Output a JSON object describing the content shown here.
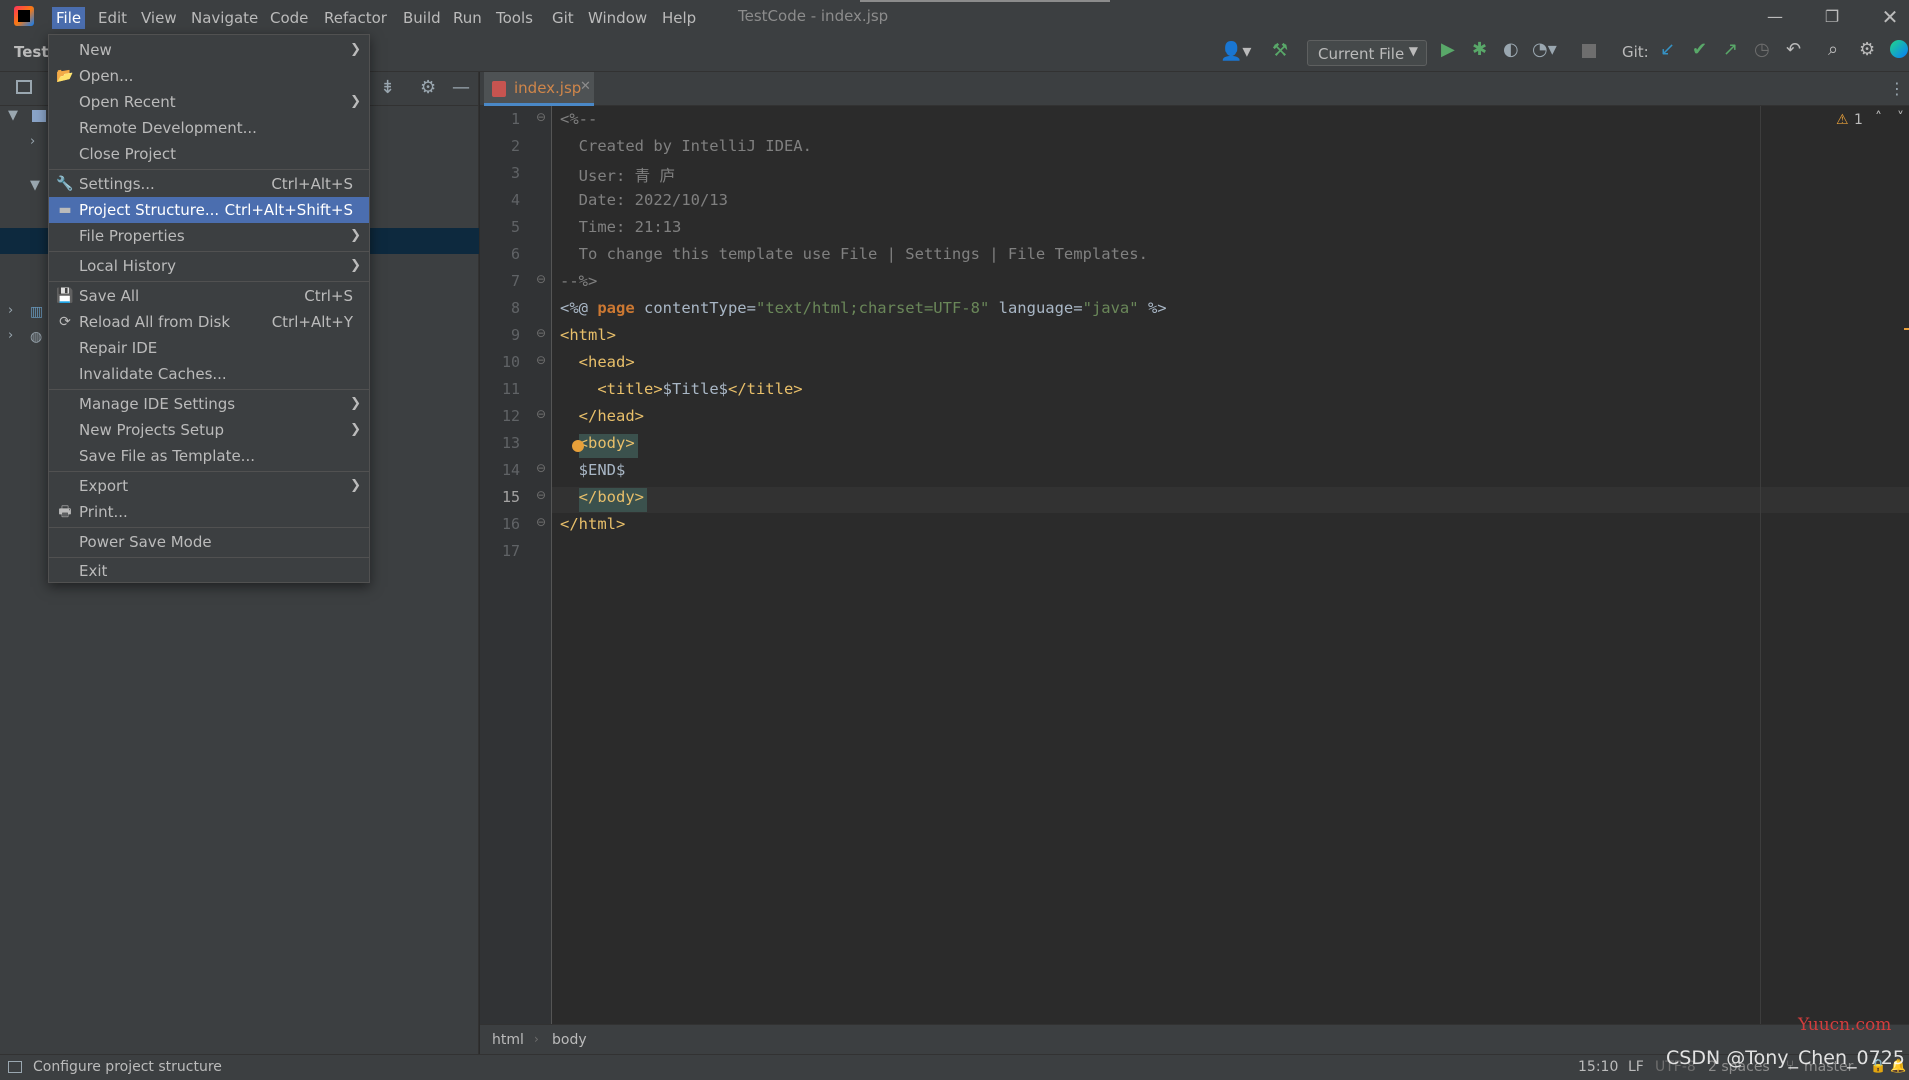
{
  "menubar": {
    "items": [
      "File",
      "Edit",
      "View",
      "Navigate",
      "Code",
      "Refactor",
      "Build",
      "Run",
      "Tools",
      "Git",
      "Window",
      "Help"
    ],
    "window_title": "TestCode - index.jsp"
  },
  "toolbar": {
    "project_label": "Test",
    "run_config": "Current File",
    "git_label": "Git:"
  },
  "file_menu": {
    "items": [
      {
        "label": "New",
        "shortcut": "",
        "submenu": true
      },
      {
        "label": "Open...",
        "shortcut": "",
        "submenu": false
      },
      {
        "label": "Open Recent",
        "shortcut": "",
        "submenu": true
      },
      {
        "label": "Remote Development...",
        "shortcut": "",
        "submenu": false
      },
      {
        "label": "Close Project",
        "shortcut": "",
        "submenu": false
      },
      {
        "label": "Settings...",
        "shortcut": "Ctrl+Alt+S",
        "submenu": false
      },
      {
        "label": "Project Structure...",
        "shortcut": "Ctrl+Alt+Shift+S",
        "submenu": false
      },
      {
        "label": "File Properties",
        "shortcut": "",
        "submenu": true
      },
      {
        "label": "Local History",
        "shortcut": "",
        "submenu": true
      },
      {
        "label": "Save All",
        "shortcut": "Ctrl+S",
        "submenu": false
      },
      {
        "label": "Reload All from Disk",
        "shortcut": "Ctrl+Alt+Y",
        "submenu": false
      },
      {
        "label": "Repair IDE",
        "shortcut": "",
        "submenu": false
      },
      {
        "label": "Invalidate Caches...",
        "shortcut": "",
        "submenu": false
      },
      {
        "label": "Manage IDE Settings",
        "shortcut": "",
        "submenu": true
      },
      {
        "label": "New Projects Setup",
        "shortcut": "",
        "submenu": true
      },
      {
        "label": "Save File as Template...",
        "shortcut": "",
        "submenu": false
      },
      {
        "label": "Export",
        "shortcut": "",
        "submenu": true
      },
      {
        "label": "Print...",
        "shortcut": "",
        "submenu": false
      },
      {
        "label": "Power Save Mode",
        "shortcut": "",
        "submenu": false
      },
      {
        "label": "Exit",
        "shortcut": "",
        "submenu": false
      }
    ],
    "selected": "Project Structure..."
  },
  "editor": {
    "tab_label": "index.jsp",
    "warnings_count": "1",
    "line_numbers": [
      "1",
      "2",
      "3",
      "4",
      "5",
      "6",
      "7",
      "8",
      "9",
      "10",
      "11",
      "12",
      "13",
      "14",
      "15",
      "16",
      "17"
    ],
    "current_line": "15",
    "code": {
      "l1": "<%--",
      "l2": "  Created by IntelliJ IDEA.",
      "l3": "  User: 青 庐",
      "l4": "  Date: 2022/10/13",
      "l5": "  Time: 21:13",
      "l6": "  To change this template use File | Settings | File Templates.",
      "l7": "--%>",
      "l8_a": "<%@ ",
      "l8_b": "page",
      "l8_c": " contentType=",
      "l8_d": "\"text/html;charset=UTF-8\"",
      "l8_e": " language=",
      "l8_f": "\"java\"",
      "l8_g": " %>",
      "l9": "<html>",
      "l10": "  <head>",
      "l11_a": "    <title>",
      "l11_b": "$Title$",
      "l11_c": "</title>",
      "l12": "  </head>",
      "l13": "  <body>",
      "l14": "  $END$",
      "l15": "  </body>",
      "l16": "</html>",
      "l17": ""
    }
  },
  "breadcrumbs": [
    "html",
    "body"
  ],
  "statusbar": {
    "message": "Configure project structure",
    "position": "15:10",
    "line_sep": "LF",
    "encoding": "UTF-8",
    "indent": "2 spaces",
    "branch": "master"
  },
  "watermarks": {
    "yuucn": "Yuucn.com",
    "csdn": "CSDN @Tony_Chen_0725"
  }
}
